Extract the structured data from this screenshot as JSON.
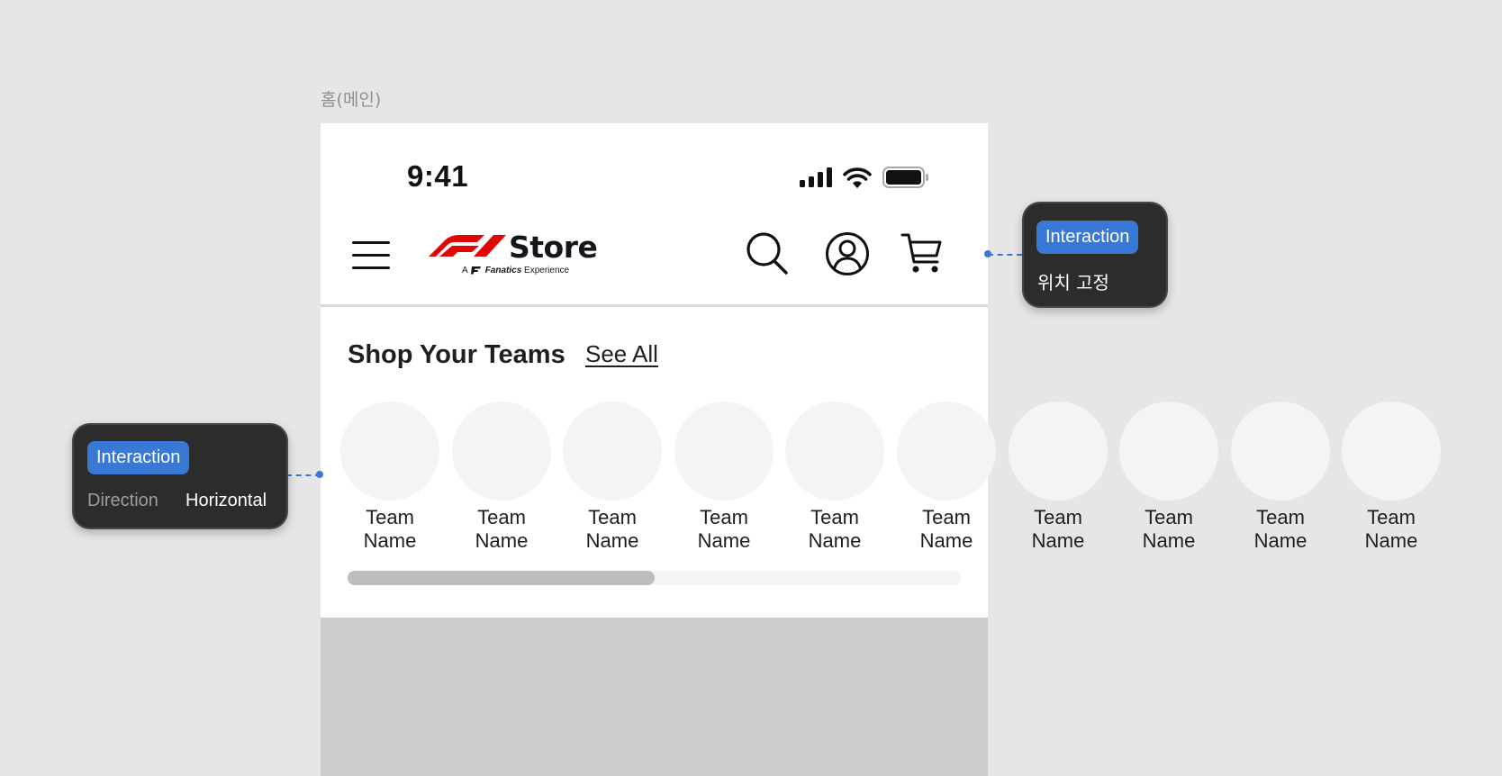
{
  "frame": {
    "label": "홈(메인)"
  },
  "status_bar": {
    "time": "9:41",
    "icons": [
      "cellular-signal-icon",
      "wifi-icon",
      "battery-icon"
    ]
  },
  "header": {
    "logo": {
      "wordmark": "Store",
      "tagline_prefix": "A",
      "tagline_brand": "Fanatics",
      "tagline_suffix": "Experience"
    },
    "icons": [
      "menu-icon",
      "search-icon",
      "account-icon",
      "cart-icon"
    ]
  },
  "shop_teams": {
    "title": "Shop Your Teams",
    "see_all": "See All",
    "teams": [
      {
        "name_line1": "Team",
        "name_line2": "Name"
      },
      {
        "name_line1": "Team",
        "name_line2": "Name"
      },
      {
        "name_line1": "Team",
        "name_line2": "Name"
      },
      {
        "name_line1": "Team",
        "name_line2": "Name"
      },
      {
        "name_line1": "Team",
        "name_line2": "Name"
      },
      {
        "name_line1": "Team",
        "name_line2": "Name"
      },
      {
        "name_line1": "Team",
        "name_line2": "Name"
      },
      {
        "name_line1": "Team",
        "name_line2": "Name"
      },
      {
        "name_line1": "Team",
        "name_line2": "Name"
      },
      {
        "name_line1": "Team",
        "name_line2": "Name"
      }
    ],
    "scroll_position_fraction": 0.5
  },
  "annotations": {
    "header_note": {
      "badge": "Interaction",
      "text": "위치 고정"
    },
    "teams_note": {
      "badge": "Interaction",
      "key": "Direction",
      "value": "Horizontal"
    }
  },
  "colors": {
    "accent": "#3a78d6",
    "f1_red": "#e10600",
    "canvas": "#e6e6e6",
    "tooltip_bg": "#2c2c2c"
  }
}
